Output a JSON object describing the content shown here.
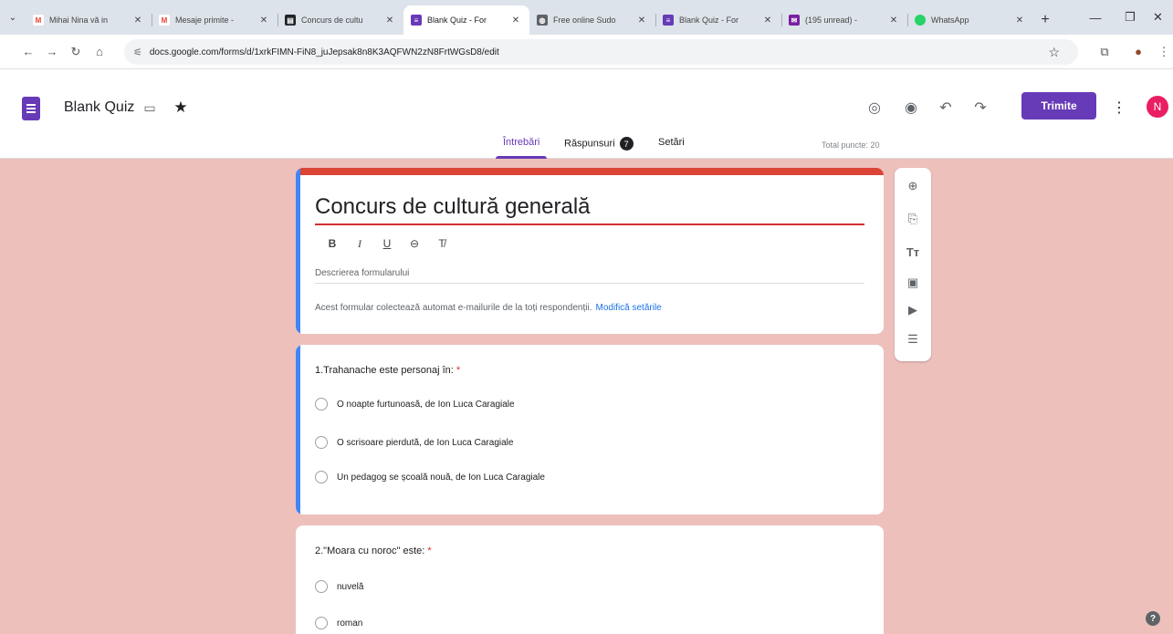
{
  "browser": {
    "tabs": [
      {
        "title": "Mihai Nina vă in",
        "fav_color": "#ea4335",
        "fav_glyph": "M"
      },
      {
        "title": "Mesaje primite -",
        "fav_color": "#ea4335",
        "fav_glyph": "M"
      },
      {
        "title": "Concurs de cultu",
        "fav_color": "#202124",
        "fav_glyph": "▤"
      },
      {
        "title": "Blank Quiz - For",
        "fav_color": "#673ab7",
        "fav_glyph": "≡",
        "active": true
      },
      {
        "title": "Free online Sudo",
        "fav_color": "#5f6368",
        "fav_glyph": "◍"
      },
      {
        "title": "Blank Quiz - For",
        "fav_color": "#673ab7",
        "fav_glyph": "≡"
      },
      {
        "title": "(195 unread) -",
        "fav_color": "#7b1fa2",
        "fav_glyph": "✉"
      },
      {
        "title": "WhatsApp",
        "fav_color": "#25d366",
        "fav_glyph": "●"
      }
    ],
    "url": "docs.google.com/forms/d/1xrkFIMN-FiN8_juJepsak8n8K3AQFWN2zN8FrtWGsD8/edit"
  },
  "header": {
    "doc_title": "Blank Quiz",
    "send_label": "Trimite",
    "avatar_letter": "N",
    "brand_color": "#673ab7"
  },
  "form_tabs": {
    "questions": "Întrebări",
    "responses": "Răspunsuri",
    "responses_count": "7",
    "settings": "Setări",
    "total_points": "Total puncte: 20"
  },
  "form": {
    "title": "Concurs de cultură generală",
    "description_placeholder": "Descrierea formularului",
    "collect_notice": "Acest formular colectează automat e-mailurile de la toți respondenții.",
    "collect_link": "Modifică setările"
  },
  "questions": [
    {
      "title": "1.Trahanache este personaj în:",
      "options": [
        "O noapte furtunoasă, de Ion Luca Caragiale",
        "O scrisoare pierdută, de Ion Luca Caragiale",
        "Un pedagog se școală nouă, de Ion Luca Caragiale"
      ]
    },
    {
      "title": "2.\"Moara cu noroc\" este:",
      "options": [
        "nuvelă",
        "roman"
      ]
    }
  ],
  "required_mark": "*"
}
